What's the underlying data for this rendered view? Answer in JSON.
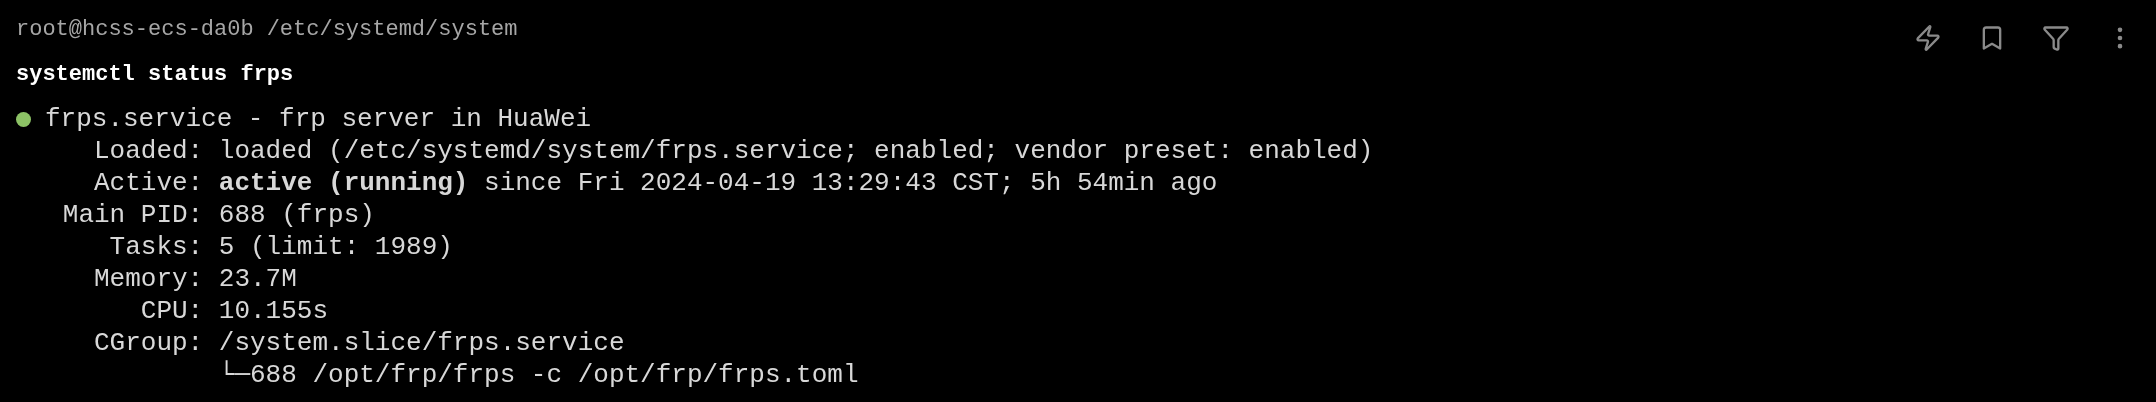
{
  "prompt": {
    "user_host": "root@hcss-ecs-da0b",
    "path": "/etc/systemd/system"
  },
  "command": "systemctl status frps",
  "service": {
    "active": true,
    "title": "frps.service - frp server in HuaWei"
  },
  "fields": [
    {
      "label": "Loaded:",
      "value": "loaded (/etc/systemd/system/frps.service; enabled; vendor preset: enabled)"
    },
    {
      "label": "Active:",
      "value": "**active (running)** since Fri 2024-04-19 13:29:43 CST; 5h 54min ago"
    },
    {
      "label": "Main PID:",
      "value": "688 (frps)"
    },
    {
      "label": "Tasks:",
      "value": "5 (limit: 1989)"
    },
    {
      "label": "Memory:",
      "value": "23.7M"
    },
    {
      "label": "CPU:",
      "value": "10.155s"
    },
    {
      "label": "CGroup:",
      "value": "/system.slice/frps.service"
    },
    {
      "value": "└─688 /opt/frp/frps -c /opt/frp/frps.toml"
    }
  ],
  "toolbar": [
    {
      "kind": "zap"
    },
    {
      "kind": "bookmark"
    },
    {
      "kind": "filter"
    },
    {
      "kind": "more"
    }
  ]
}
